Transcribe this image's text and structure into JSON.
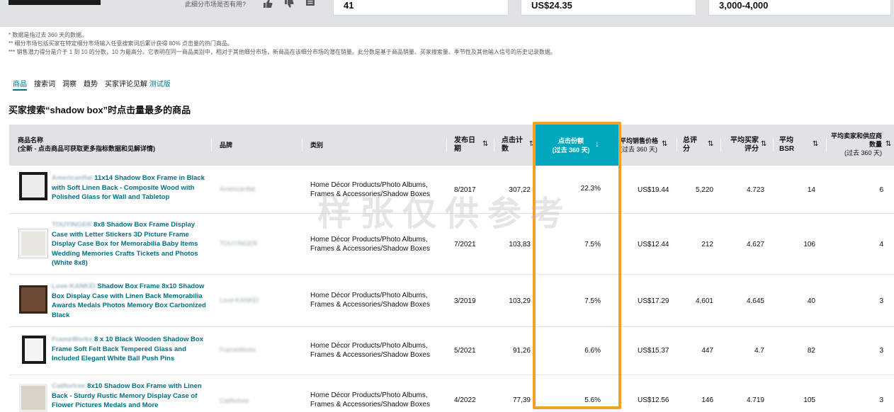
{
  "top": {
    "useful_prompt": "此细分市场是否有用?",
    "card1_value": "41",
    "card2_value": "US$24.35",
    "card3_value": "3,000-4,000"
  },
  "notes": [
    "* 数据是指过去 360 天的数据。",
    "** 细分市场包括买家在特定细分市场输入任意搜索词后累计获得 80% 点击量的热门商品。",
    "*** 销售潜力得分是介于 1 到 10 的分数，10 为最高分。它表明在同一商品类别中，相对于其他细分市场，新商品在该细分市场的潜在销量。此分数是基于商品销量、买家搜索量、季节性及其他输入信号的历史记录数据。"
  ],
  "tabs": [
    "商品",
    "搜索词",
    "洞察",
    "趋势",
    "买家评论见解"
  ],
  "tab_beta": "测试版",
  "section_title": "买家搜索“shadow box”时点击量最多的商品",
  "headers": {
    "product_name": "商品名称",
    "product_name_sub": "(全新 - 点击商品可获取更多指标数据和见解详情)",
    "brand": "品牌",
    "category": "类别",
    "launch_date": "发布日期",
    "clicks": "点击计数",
    "click_share": "点击份额",
    "click_share_sub": "(过去 360 天)",
    "avg_price": "平均销售价格",
    "avg_price_sub": "(过去 360 天)",
    "total_reviews": "总评分",
    "avg_rating": "平均买家评分",
    "avg_bsr": "平均BSR",
    "avg_sellers": "平均卖家和供应商数量",
    "avg_sellers_sub": "(过去 360 天)"
  },
  "watermark": "样张仅供参考",
  "rows": [
    {
      "brand_prefix": "Americanflat",
      "title": "11x14 Shadow Box Frame in Black with Soft Linen Back - Composite Wood with Polished Glass for Wall and Tabletop",
      "brand": "Americanflat",
      "category": "Home Décor Products/Photo Albums, Frames & Accessories/Shadow Boxes",
      "date": "8/2017",
      "clicks": "307,22",
      "share": "22.3%",
      "price": "US$19.44",
      "reviews": "5,220",
      "rating": "4.723",
      "bsr": "14",
      "sellers": "6"
    },
    {
      "brand_prefix": "TOUYINGER",
      "title": "8x8 Shadow Box Frame Display Case with Letter Stickers 3D Picture Frame Display Case Box for Memorabilia Baby Items Wedding Memories Crafts Tickets and Photos (White 8x8)",
      "brand": "TOUYINGER",
      "category": "Home Décor Products/Photo Albums, Frames & Accessories/Shadow Boxes",
      "date": "7/2021",
      "clicks": "103,83",
      "share": "7.5%",
      "price": "US$12.44",
      "reviews": "212",
      "rating": "4.627",
      "bsr": "106",
      "sellers": "4"
    },
    {
      "brand_prefix": "Love-KANKEI",
      "title": "Shadow Box Frame 8x10 Shadow Box Display Case with Linen Back Memorabilia Awards Medals Photos Memory Box Carbonized Black",
      "brand": "Love-KANKEI",
      "category": "Home Décor Products/Photo Albums, Frames & Accessories/Shadow Boxes",
      "date": "3/2019",
      "clicks": "103,29",
      "share": "7.5%",
      "price": "US$17.29",
      "reviews": "4,601",
      "rating": "4.645",
      "bsr": "40",
      "sellers": "3"
    },
    {
      "brand_prefix": "FrameWorks",
      "title": "8 x 10 Black Wooden Shadow Box Frame Soft Felt Back Tempered Glass and Included Elegant White Ball Push Pins",
      "brand": "FrameWorks",
      "category": "Home Décor Products/Photo Albums, Frames & Accessories/Shadow Boxes",
      "date": "5/2021",
      "clicks": "91,26",
      "share": "6.6%",
      "price": "US$15.37",
      "reviews": "447",
      "rating": "4.7",
      "bsr": "82",
      "sellers": "3"
    },
    {
      "brand_prefix": "Califortree",
      "title": "8x10 Shadow Box Frame with Linen Back - Sturdy Rustic Memory Display Case of Flower Pictures Medals and More",
      "brand": "Califortree",
      "category": "Home Décor Products/Photo Albums, Frames & Accessories/Shadow Boxes",
      "date": "4/2022",
      "clicks": "77,39",
      "share": "5.6%",
      "price": "US$12.56",
      "reviews": "146",
      "rating": "4.719",
      "bsr": "105",
      "sellers": "3"
    }
  ]
}
